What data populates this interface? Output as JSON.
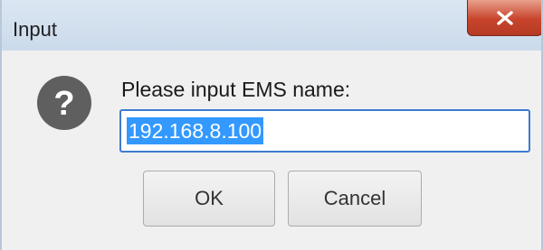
{
  "window": {
    "title": "Input",
    "close_glyph": "x"
  },
  "dialog": {
    "icon": "question-icon",
    "prompt": "Please input EMS name:",
    "input_value": "192.168.8.100",
    "ok_label": "OK",
    "cancel_label": "Cancel"
  },
  "colors": {
    "titlebar": "#cbdaeb",
    "close_button": "#c8442c",
    "selection": "#3399ff",
    "input_border": "#3d7bd0",
    "background": "#f0f0f0"
  }
}
